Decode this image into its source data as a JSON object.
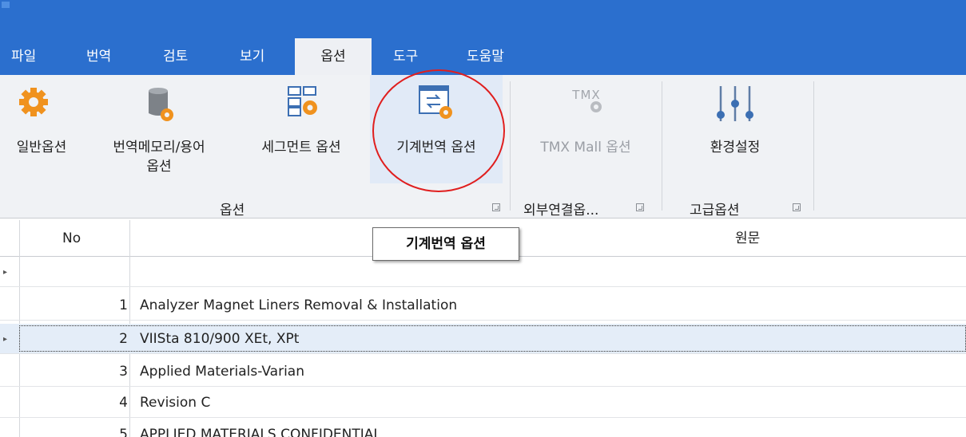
{
  "ribbon_tabs": [
    {
      "label": "파일",
      "active": false
    },
    {
      "label": "번역",
      "active": false
    },
    {
      "label": "검토",
      "active": false
    },
    {
      "label": "보기",
      "active": false
    },
    {
      "label": "옵션",
      "active": true
    },
    {
      "label": "도구",
      "active": false
    },
    {
      "label": "도움말",
      "active": false
    }
  ],
  "ribbon": {
    "buttons": [
      {
        "label": "일반옵션",
        "icon": "gear-icon"
      },
      {
        "label": "번역메모리/용어",
        "label2": "옵션",
        "icon": "database-gear-icon"
      },
      {
        "label": "세그먼트 옵션",
        "icon": "segment-gear-icon"
      },
      {
        "label": "기계번역 옵션",
        "icon": "machine-translation-icon"
      },
      {
        "label": "TMX Mall 옵션",
        "icon": "tmx-icon",
        "disabled": true
      },
      {
        "label": "환경설정",
        "icon": "sliders-icon"
      }
    ],
    "groups": [
      {
        "label": "옵션"
      },
      {
        "label": "외부연결옵..."
      },
      {
        "label": "고급옵션"
      }
    ],
    "tmx_icon_text": "TMX"
  },
  "tooltip": {
    "text": "기계번역 옵션"
  },
  "grid": {
    "columns": [
      "No",
      "원문"
    ],
    "rows": [
      {
        "no": "",
        "source": ""
      },
      {
        "no": "1",
        "source": "Analyzer Magnet Liners Removal & Installation"
      },
      {
        "no": "2",
        "source": "VIISta 810/900 XEt, XPt",
        "selected": true
      },
      {
        "no": "3",
        "source": "Applied Materials-Varian"
      },
      {
        "no": "4",
        "source": "Revision C"
      },
      {
        "no": "5",
        "source": "APPLIED MATERIALS CONFIDENTIAL"
      }
    ]
  },
  "colors": {
    "title_bar": "#2b6fce",
    "ribbon_bg": "#f0f2f5",
    "accent_orange": "#f0921e",
    "selected_row": "#e4edf8",
    "annotation": "#e01e1e"
  }
}
